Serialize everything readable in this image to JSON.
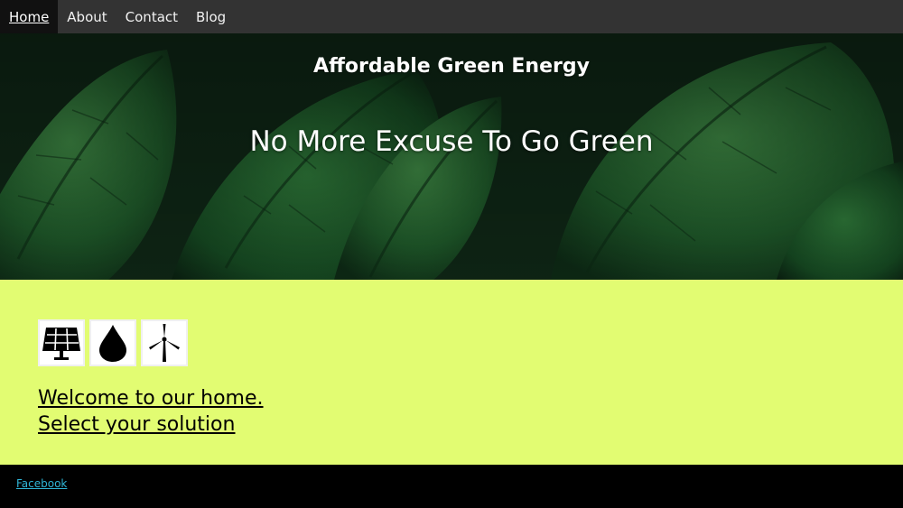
{
  "nav": {
    "items": [
      {
        "label": "Home",
        "active": true
      },
      {
        "label": "About",
        "active": false
      },
      {
        "label": "Contact",
        "active": false
      },
      {
        "label": "Blog",
        "active": false
      }
    ]
  },
  "hero": {
    "title": "Affordable Green Energy",
    "tagline": "No More Excuse To Go Green",
    "background": "green-leaves-photo"
  },
  "main": {
    "icons": [
      "solar-panel-icon",
      "water-drop-icon",
      "wind-turbine-icon"
    ],
    "welcome_line1": "Welcome to our home.",
    "welcome_line2": "Select your solution"
  },
  "footer": {
    "link": "Facebook"
  },
  "colors": {
    "nav_bg": "#333333",
    "nav_active_bg": "#111111",
    "main_bg": "#e2fc72",
    "footer_bg": "#000000",
    "footer_link": "#2fb5d6"
  }
}
